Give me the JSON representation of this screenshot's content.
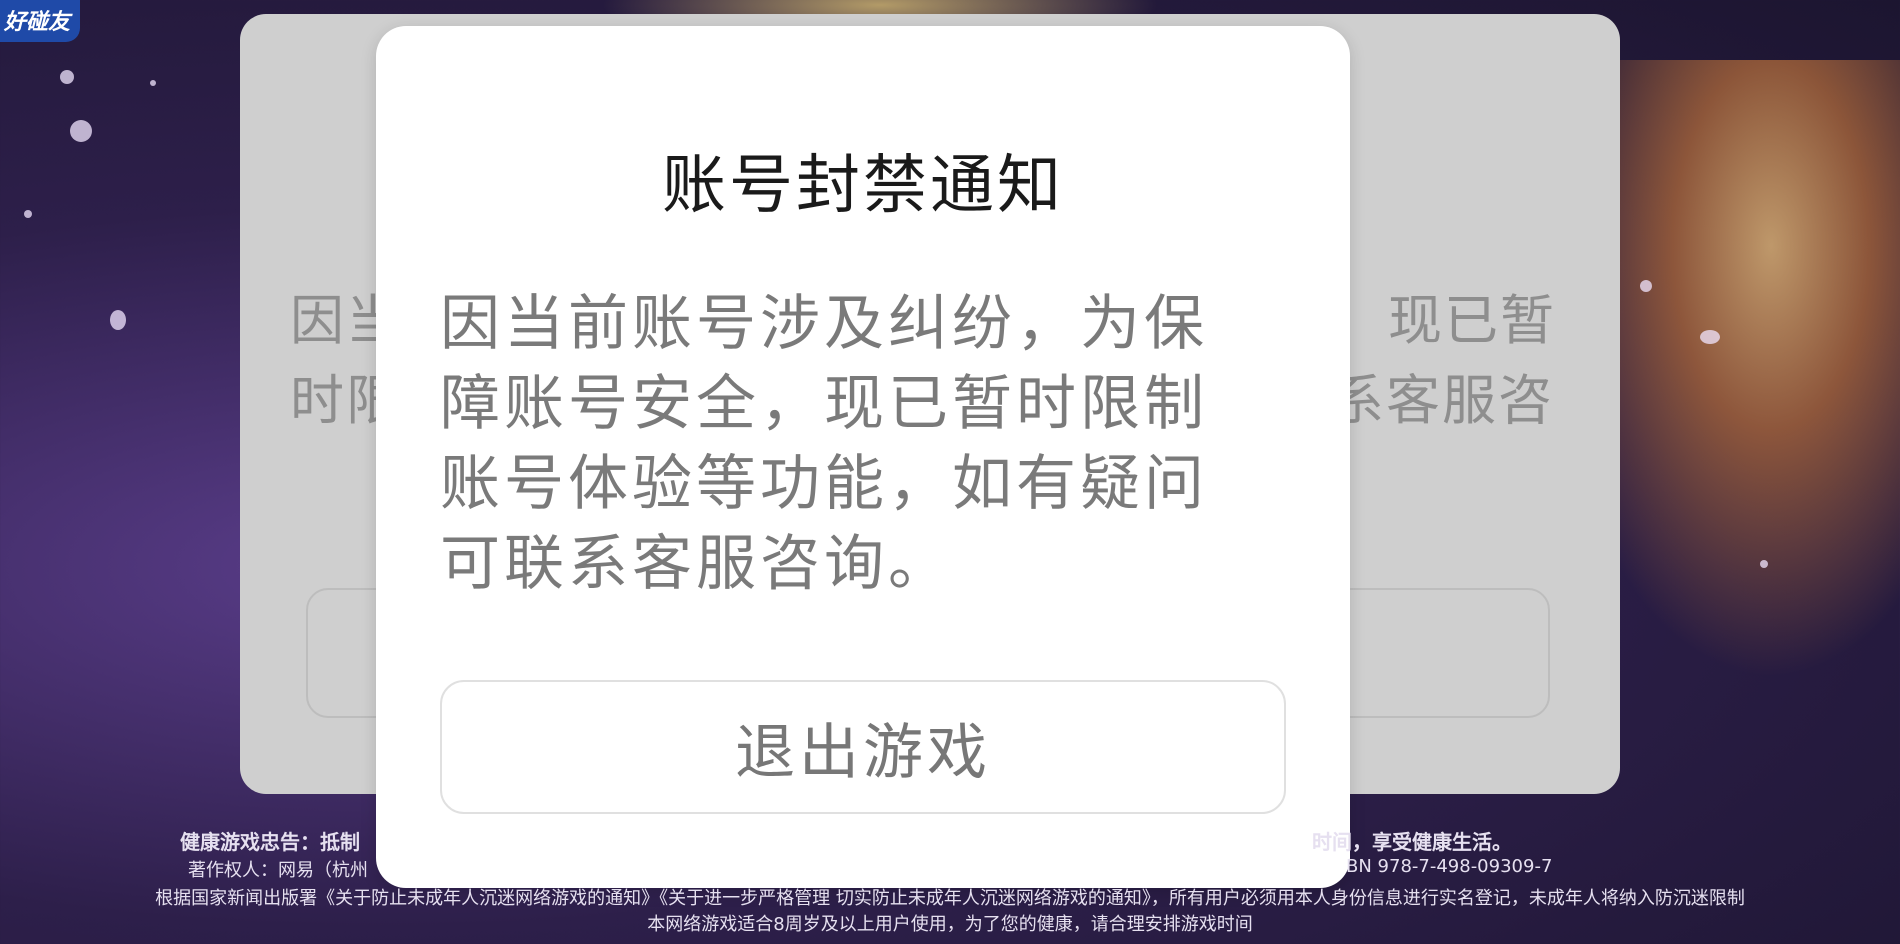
{
  "game": {
    "logo_text": "好碰友"
  },
  "background_dialog": {
    "line1_left": "因当",
    "line1_right": "现已暂",
    "line2_left": "时限",
    "line2_right": "系客服咨"
  },
  "dialog": {
    "title": "账号封禁通知",
    "message": "因当前账号涉及纠纷，为保障账号安全，现已暂时限制账号体验等功能，如有疑问可联系客服咨询。",
    "exit_button_label": "退出游戏"
  },
  "footer": {
    "health_notice_left": "健康游戏忠告：抵制",
    "health_notice_right": "时间，享受健康生活。",
    "copyright_left": "著作权人：网易（杭州",
    "copyright_right": "BN 978-7-498-09309-7",
    "policy_notice": "根据国家新闻出版署《关于防止未成年人沉迷网络游戏的通知》《关于进一步严格管理 切实防止未成年人沉迷网络游戏的通知》，所有用户必须用本人身份信息进行实名登记，未成年人将纳入防沉迷限制",
    "age_notice": "本网络游戏适合8周岁及以上用户使用，为了您的健康，请合理安排游戏时间"
  }
}
